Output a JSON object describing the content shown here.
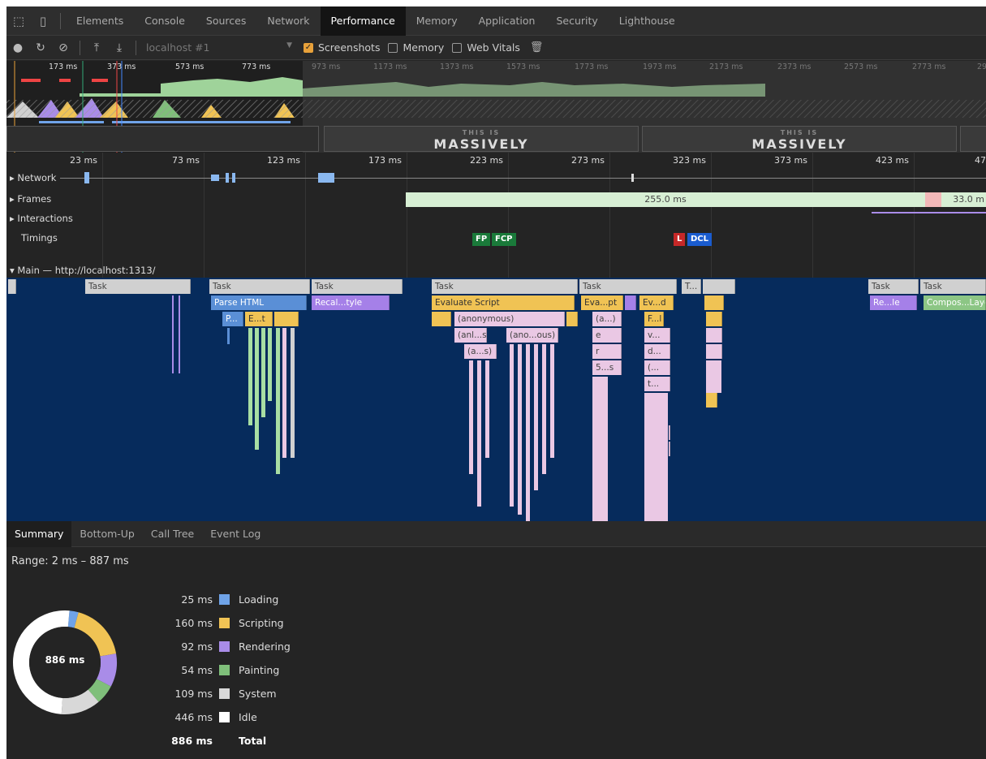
{
  "tabs": [
    {
      "label": "Elements"
    },
    {
      "label": "Console"
    },
    {
      "label": "Sources"
    },
    {
      "label": "Network"
    },
    {
      "label": "Performance",
      "active": true
    },
    {
      "label": "Memory"
    },
    {
      "label": "Application"
    },
    {
      "label": "Security"
    },
    {
      "label": "Lighthouse"
    }
  ],
  "toolbar": {
    "profile_select": "localhost #1",
    "screenshots_label": "Screenshots",
    "memory_label": "Memory",
    "webvitals_label": "Web Vitals",
    "screenshots_checked": true
  },
  "overview": {
    "ticks": [
      "173 ms",
      "373 ms",
      "573 ms",
      "773 ms",
      "973 ms",
      "1173 ms",
      "1373 ms",
      "1573 ms",
      "1773 ms",
      "1973 ms",
      "2173 ms",
      "2373 ms",
      "2573 ms",
      "2773 ms",
      "29"
    ],
    "screenshot_caption": "MASSIVELY",
    "screenshot_caption_top": "THIS IS"
  },
  "ruler": {
    "ticks": [
      "23 ms",
      "73 ms",
      "123 ms",
      "173 ms",
      "223 ms",
      "273 ms",
      "323 ms",
      "373 ms",
      "423 ms",
      "47"
    ]
  },
  "tracks": {
    "network": "▸ Network",
    "frames": "▸ Frames",
    "interactions": "▸ Interactions",
    "timings": "Timings",
    "frame_duration_1": "255.0 ms",
    "frame_duration_2": "33.0 m"
  },
  "markers": {
    "fp": "FP",
    "fcp": "FCP",
    "l": "L",
    "dcl": "DCL"
  },
  "main": {
    "header": "▾ Main — http://localhost:1313/",
    "task": "Task",
    "task_short": "T...",
    "parse_html": "Parse HTML",
    "recalc": "Recal...tyle",
    "evaluate_script": "Evaluate Script",
    "eva_pt": "Eva...pt",
    "ev_d": "Ev...d",
    "re_le": "Re...le",
    "compos": "Compos...Layers",
    "p_short": "P...",
    "e_t": "E...t",
    "anonymous": "(anonymous)",
    "anl_s": "(anl...s)",
    "ano_ous": "(ano...ous)",
    "a_s": "(a...s)",
    "a_paren": "(a...)",
    "e": "e",
    "r": "r",
    "s5": "5...s",
    "f_short": "F...l",
    "v_short": "v...",
    "d_short": "d...",
    "paren": "(...",
    "t_short": "t..."
  },
  "bottom_tabs": [
    {
      "label": "Summary",
      "active": true
    },
    {
      "label": "Bottom-Up"
    },
    {
      "label": "Call Tree"
    },
    {
      "label": "Event Log"
    }
  ],
  "summary": {
    "range": "Range: 2 ms – 887 ms",
    "total_center": "886 ms",
    "rows": [
      {
        "value": "25 ms",
        "label": "Loading",
        "color": "#6fa3e8",
        "ms": 25
      },
      {
        "value": "160 ms",
        "label": "Scripting",
        "color": "#f0c354",
        "ms": 160
      },
      {
        "value": "92 ms",
        "label": "Rendering",
        "color": "#a98ce8",
        "ms": 92
      },
      {
        "value": "54 ms",
        "label": "Painting",
        "color": "#7fbf7a",
        "ms": 54
      },
      {
        "value": "109 ms",
        "label": "System",
        "color": "#d8d8d8",
        "ms": 109
      },
      {
        "value": "446 ms",
        "label": "Idle",
        "color": "#ffffff",
        "ms": 446
      }
    ],
    "total_value": "886 ms",
    "total_label": "Total"
  }
}
